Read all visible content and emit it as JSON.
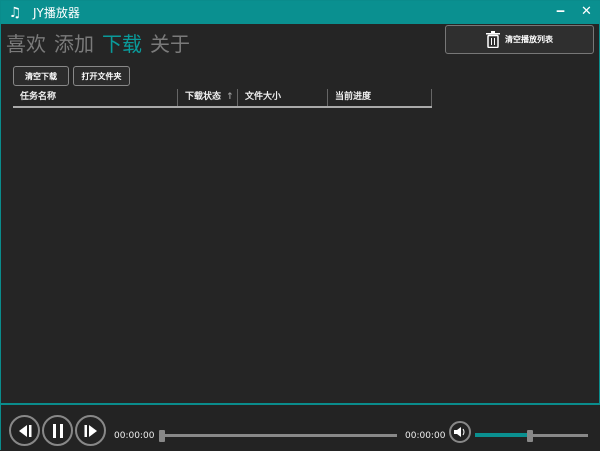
{
  "app": {
    "title": "JY播放器",
    "icon": "music-note-icon"
  },
  "window": {
    "minimize": "‒",
    "close": "✕"
  },
  "tabs": [
    {
      "label": "喜欢",
      "active": false
    },
    {
      "label": "添加",
      "active": false
    },
    {
      "label": "下载",
      "active": true
    },
    {
      "label": "关于",
      "active": false
    }
  ],
  "clear_playlist_label": "清空播放列表",
  "toolbar": {
    "clear_downloads": "清空下载",
    "open_folder": "打开文件夹"
  },
  "table": {
    "columns": [
      "任务名称",
      "下载状态",
      "文件大小",
      "当前进度"
    ],
    "sort_column": "下载状态",
    "sort_direction": "ascending",
    "rows": []
  },
  "player": {
    "current_time": "00:00:00",
    "total_time": "00:00:00",
    "progress_percent": 0,
    "volume_percent": 49
  },
  "colors": {
    "accent": "#0a9090",
    "background": "#252525"
  }
}
